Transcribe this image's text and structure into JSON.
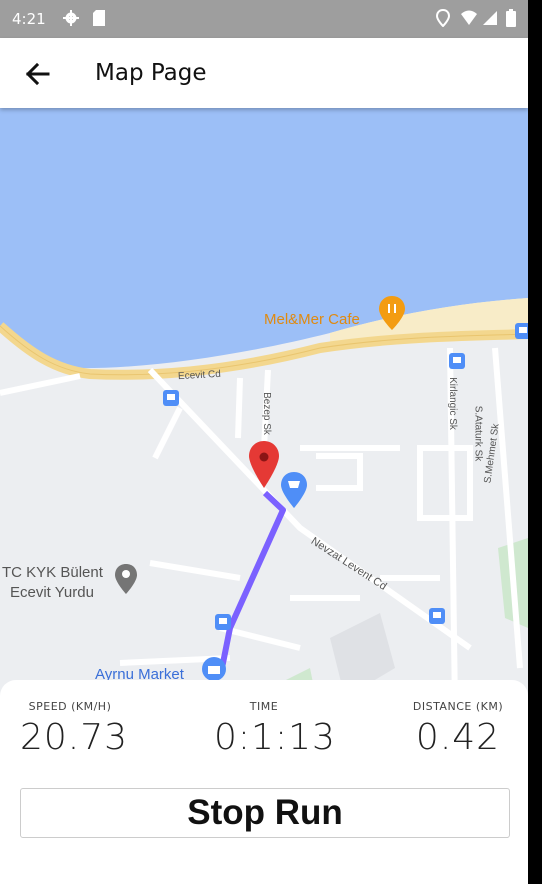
{
  "status_bar": {
    "time": "4:21",
    "left_icons": [
      "settings-icon",
      "sd-card-icon"
    ],
    "right_icons": [
      "location-icon",
      "wifi-icon",
      "signal-icon",
      "battery-icon"
    ]
  },
  "app_bar": {
    "title": "Map Page",
    "back_icon": "arrow-back-icon"
  },
  "map": {
    "labels": {
      "cafe": "Mel&Mer Cafe",
      "road_ecevit": "Ecevit Cd",
      "road_vertical": "Bezep Sk",
      "road_kirlangic": "Kirlangic Sk",
      "road_ataturk": "S.Ataturk Sk",
      "road_sehitler": "S.Mehmet Sk",
      "road_levent": "Nevzat Levent Cd",
      "dorm_line1": "TC KYK Bülent",
      "dorm_line2": "Ecevit Yurdu",
      "market": "Ayrnu Market"
    },
    "colors": {
      "water": "#9cbff7",
      "land": "#eceef1",
      "highway": "#f3d78e",
      "route": "#7b61ff",
      "pin": "#e53935",
      "poi_blue": "#4f8ef7",
      "poi_orange": "#f39c12",
      "park": "#cfe8cf"
    }
  },
  "stats": {
    "speed": {
      "label": "SPEED (KM/H)",
      "value": "20.73"
    },
    "time": {
      "label": "TIME",
      "value": "0:1:13"
    },
    "distance": {
      "label": "DISTANCE (KM)",
      "value": "0.42"
    }
  },
  "stop_button": {
    "label": "Stop Run"
  }
}
